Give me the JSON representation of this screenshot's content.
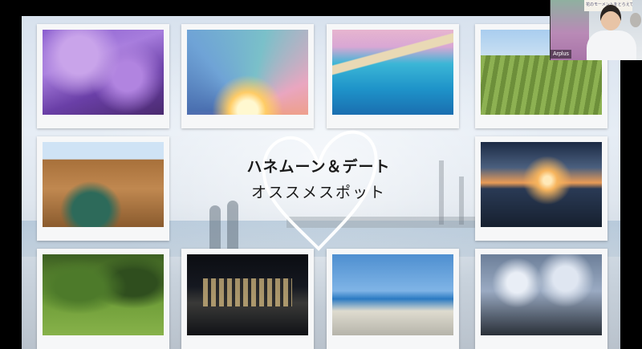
{
  "slide": {
    "title_line1": "ハネムーン＆デート",
    "title_line2": "オススメスポット"
  },
  "photos": [
    {
      "id": "p1",
      "subject": "purple-jacaranda-trees"
    },
    {
      "id": "p2",
      "subject": "colorful-sunrise-arch-sculpture"
    },
    {
      "id": "p3",
      "subject": "pink-lake-and-turquoise-coast"
    },
    {
      "id": "p4",
      "subject": "vineyard-rows"
    },
    {
      "id": "p5",
      "subject": "canyon-gorge"
    },
    {
      "id": "p6",
      "subject": "sunset-over-water"
    },
    {
      "id": "p7",
      "subject": "kangaroo-in-grass"
    },
    {
      "id": "p8",
      "subject": "night-cityscape-waterfront"
    },
    {
      "id": "p9",
      "subject": "beach-cafe-coast"
    },
    {
      "id": "p10",
      "subject": "port-cranes-under-clouds"
    }
  ],
  "webcam": {
    "name": "Arplus",
    "banner_text": "花のモーメントをとらえてみ。"
  },
  "colors": {
    "title_text": "#1a1a1a",
    "heart_stroke": "#ffffff",
    "photo_frame": "#f6f7f8"
  }
}
